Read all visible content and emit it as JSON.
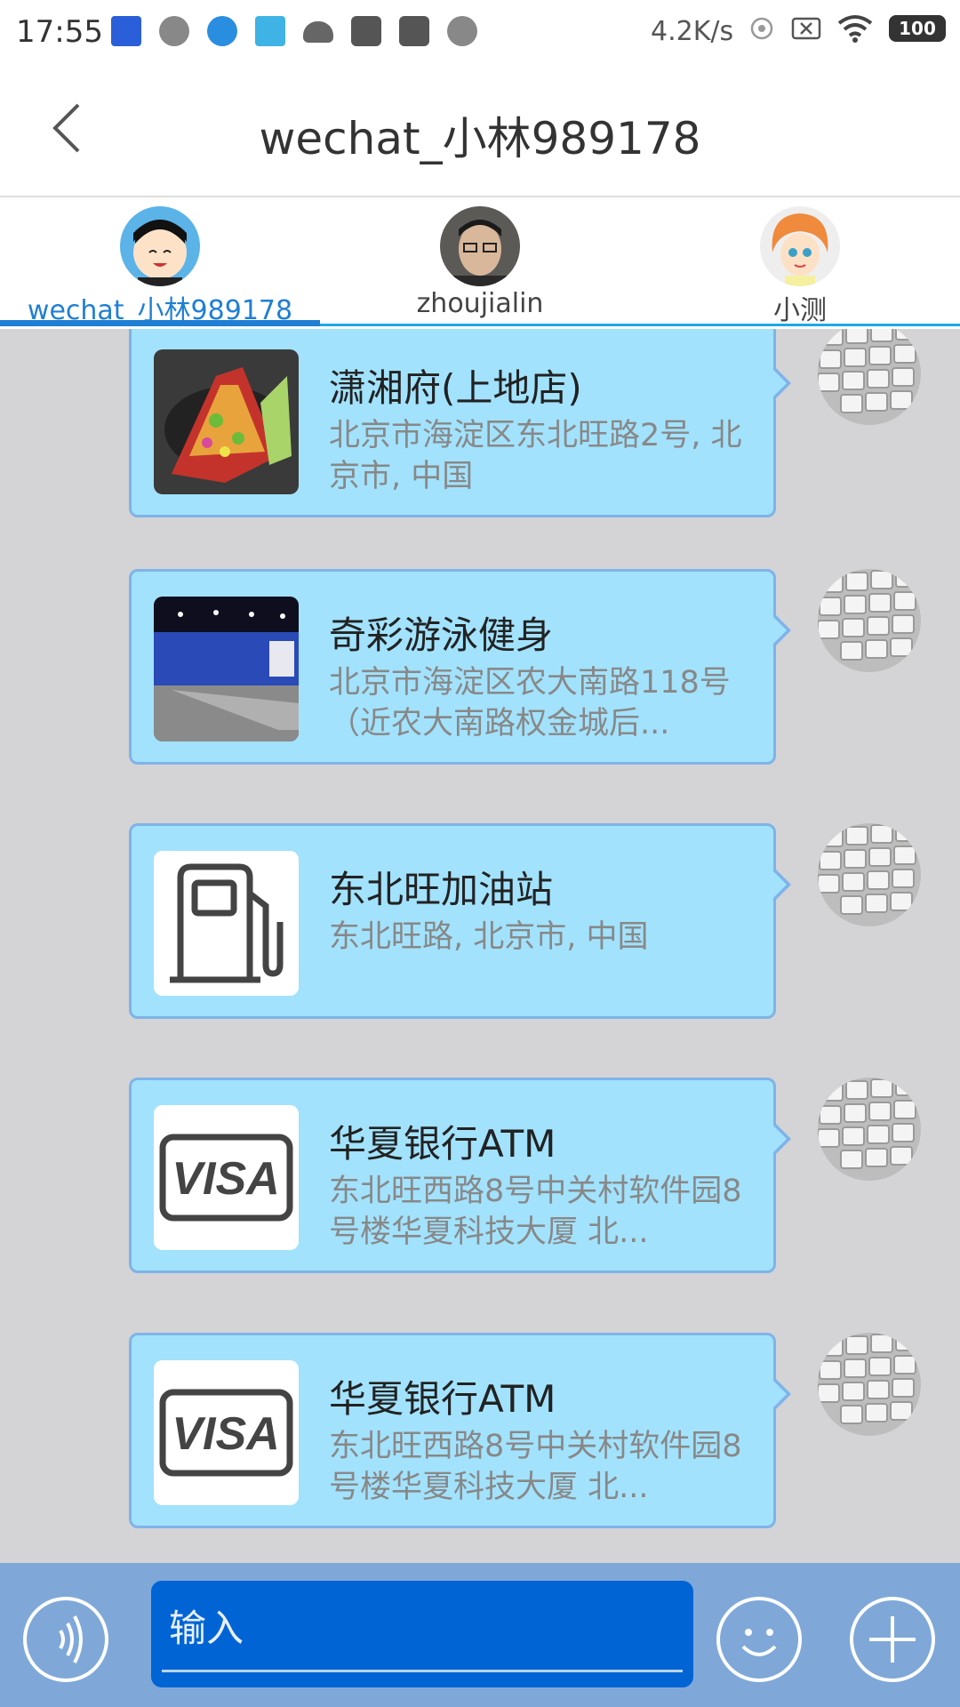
{
  "status_bar": {
    "time": "17:55",
    "net_speed": "4.2K/s",
    "battery": "100"
  },
  "header": {
    "title": "wechat_小林989178"
  },
  "tabs": [
    {
      "label": "wechat_小林989178",
      "active": true
    },
    {
      "label": "zhoujialin",
      "active": false
    },
    {
      "label": "小测",
      "active": false
    }
  ],
  "messages": [
    {
      "name": "潇湘府(上地店)",
      "address": "北京市海淀区东北旺路2号, 北京市, 中国",
      "thumb": "food-photo"
    },
    {
      "name": "奇彩游泳健身",
      "address": "北京市海淀区农大南路118号（近农大南路权金城后...",
      "thumb": "gym-photo"
    },
    {
      "name": "东北旺加油站",
      "address": "东北旺路, 北京市, 中国",
      "thumb": "gas-pump-icon"
    },
    {
      "name": "华夏银行ATM",
      "address": "东北旺西路8号中关村软件园8号楼华夏科技大厦 北...",
      "thumb": "visa-icon"
    },
    {
      "name": "华夏银行ATM",
      "address": "东北旺西路8号中关村软件园8号楼华夏科技大厦 北...",
      "thumb": "visa-icon"
    }
  ],
  "input": {
    "placeholder": "输入"
  },
  "colors": {
    "bubble": "#a2e2fd",
    "bubble_border": "#7fb3e8",
    "active_tab": "#1f7fd4",
    "input_bar": "#7fa8d9",
    "input_field": "#0064d4"
  }
}
